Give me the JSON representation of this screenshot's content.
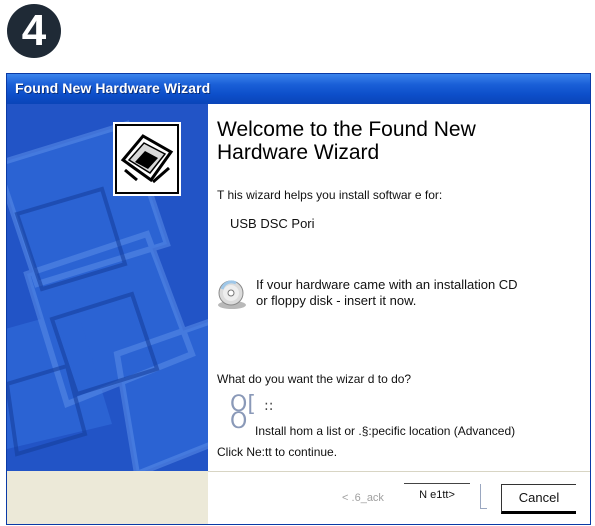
{
  "step_badge": {
    "number": "4"
  },
  "window": {
    "title": "Found New Hardware Wizard"
  },
  "heading": {
    "line1": "Welcome to the Found New",
    "line2": "Hardware Wizard"
  },
  "intro_text": "T his wizard helps you install softwar e for:",
  "device_name": "USB DSC Pori",
  "cd_note": {
    "line1": "If vour hardware came with an installation CD",
    "line2": "or floppy disk - insert it now."
  },
  "question": "What do you want the wizar d to do?",
  "radio_glyphs": {
    "top": "O[",
    "bottom": "O"
  },
  "radio_marks": "::",
  "selected_option": "Install hom a list or .§:pecific location (Advanced)",
  "continue_text": "Click Ne:tt to continue.",
  "buttons": {
    "back": "< .6_ack",
    "next": "N e1tt>",
    "cancel": "Cancel"
  },
  "colors": {
    "titlebar": "#0c4ec9",
    "side_panel": "#1e4fc0",
    "button_bar": "#ece9d8",
    "radio": "#8a99b8"
  },
  "icons": {
    "step_badge": "number-4-circle",
    "hardware": "hardware-wizard-icon",
    "cd": "cd-disc-icon"
  }
}
